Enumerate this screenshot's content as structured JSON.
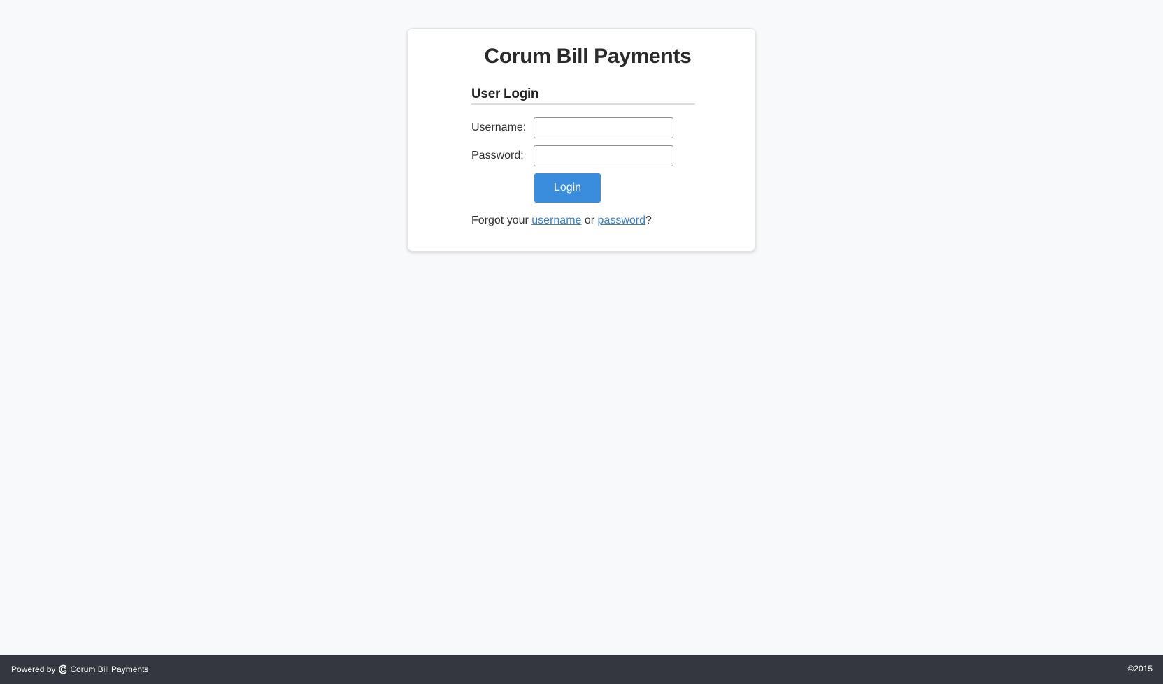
{
  "app": {
    "title": "Corum Bill Payments"
  },
  "login": {
    "section_title": "User Login",
    "username_label": "Username:",
    "username_value": "",
    "password_label": "Password:",
    "password_value": "",
    "login_button": "Login",
    "forgot_prefix": "Forgot your ",
    "forgot_username_link": "username",
    "forgot_or": " or ",
    "forgot_password_link": "password",
    "forgot_suffix": "?"
  },
  "footer": {
    "powered_by": "Powered by",
    "logo_icon": "corum-logo-icon",
    "brand": "Corum Bill Payments",
    "copyright": "©2015"
  },
  "colors": {
    "page_background": "#f8f9fa",
    "button": "#3a8ddc",
    "link": "#3a7fc8",
    "footer": "#343640"
  }
}
